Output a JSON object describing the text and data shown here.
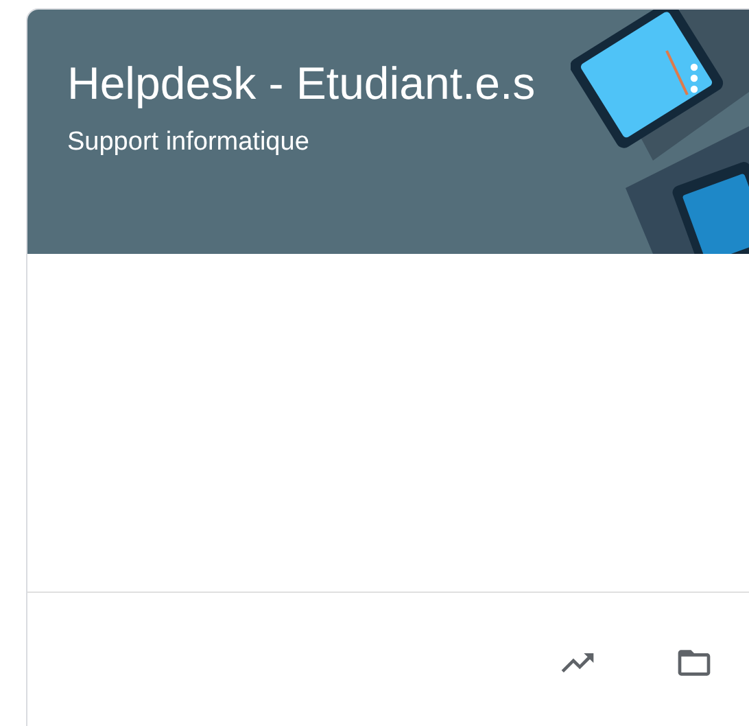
{
  "card": {
    "title": "Helpdesk - Etudiant.e.s",
    "subtitle": "Support informatique"
  }
}
